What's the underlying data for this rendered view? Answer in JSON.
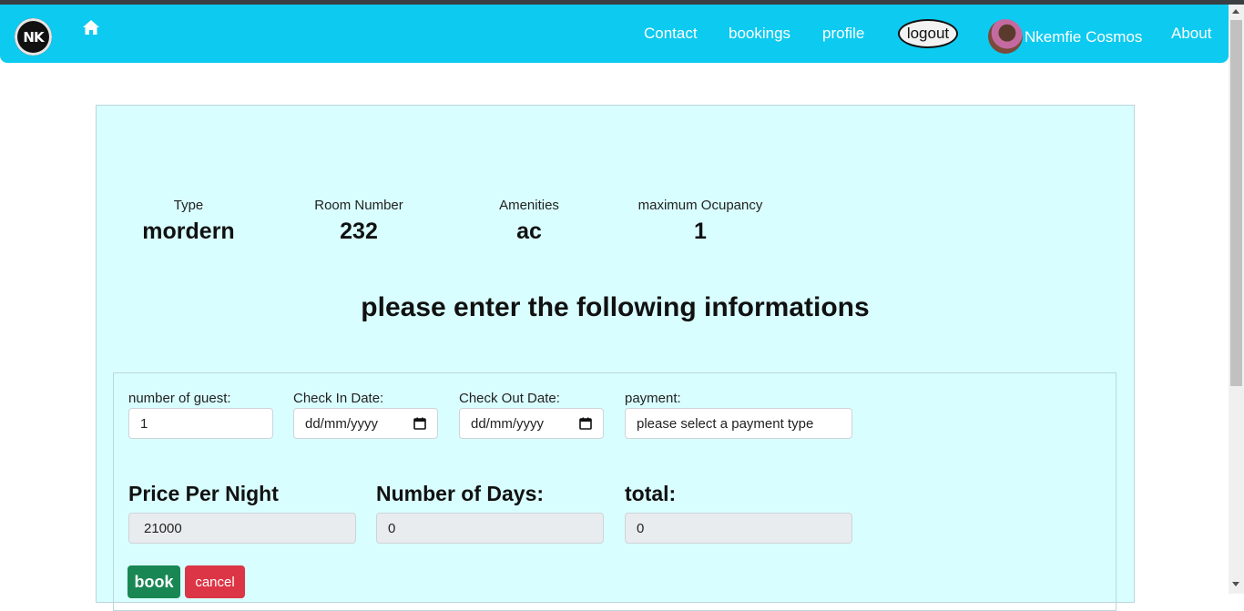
{
  "navbar": {
    "logo_text": "NK",
    "links": {
      "contact": "Contact",
      "bookings": "bookings",
      "profile": "profile",
      "logout": "logout",
      "about": "About"
    },
    "user_name": "Nkemfie Cosmos",
    "background_color": "#0dcaf0"
  },
  "room": {
    "type_label": "Type",
    "type_value": "mordern",
    "room_number_label": "Room Number",
    "room_number_value": "232",
    "amenities_label": "Amenities",
    "amenities_value": "ac",
    "max_occupancy_label": "maximum Ocupancy",
    "max_occupancy_value": "1"
  },
  "heading": "please enter the following informations",
  "form": {
    "guests_label": "number of guest:",
    "guests_value": "1",
    "checkin_label": "Check In Date:",
    "checkin_placeholder": "dd/mm/yyyy",
    "checkout_label": "Check Out Date:",
    "checkout_placeholder": "dd/mm/yyyy",
    "payment_label": "payment:",
    "payment_value": "please select a payment type",
    "price_label": "Price Per Night",
    "price_value": "21000",
    "days_label": "Number of Days:",
    "days_value": "0",
    "total_label": "total:",
    "total_value": "0",
    "book_label": "book",
    "cancel_label": "cancel"
  },
  "colors": {
    "card_background": "#d9feff",
    "book_button": "#198754",
    "cancel_button": "#dc3545"
  }
}
